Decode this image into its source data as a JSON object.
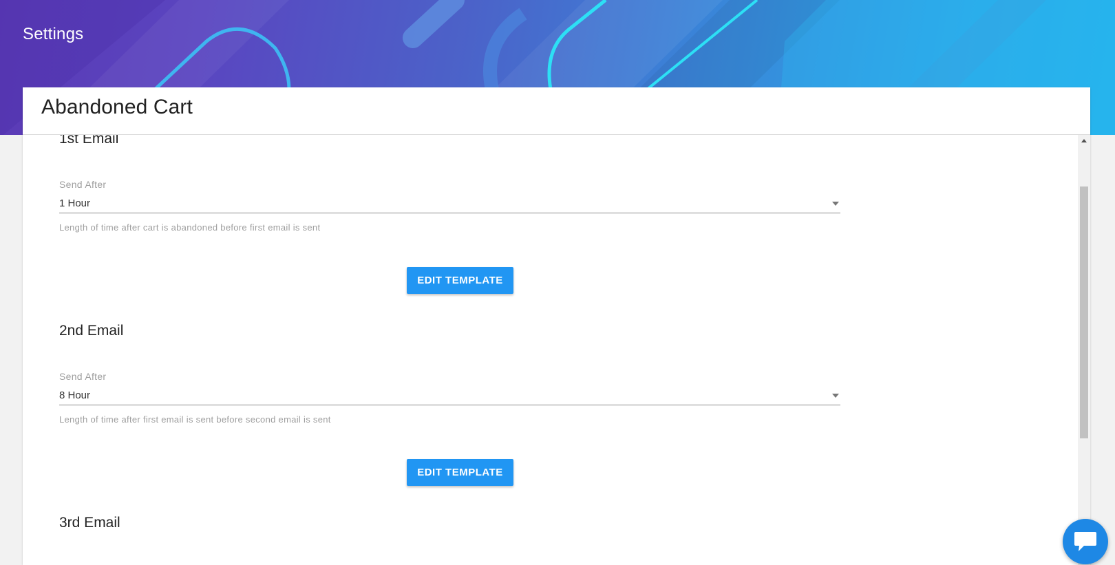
{
  "header": {
    "title": "Settings"
  },
  "card": {
    "title": "Abandoned Cart"
  },
  "emails": [
    {
      "title": "1st Email",
      "field_label": "Send After",
      "selected_value": "1 Hour",
      "helper_text": "Length of time after cart is abandoned before first email is sent",
      "button_label": "EDIT TEMPLATE"
    },
    {
      "title": "2nd Email",
      "field_label": "Send After",
      "selected_value": "8 Hour",
      "helper_text": "Length of time after first email is sent before second email is sent",
      "button_label": "EDIT TEMPLATE"
    },
    {
      "title": "3rd Email"
    }
  ],
  "colors": {
    "primary_button": "#2196f3",
    "chat_fab": "#1e88e5",
    "header_gradient_start": "#5b3ab5",
    "header_gradient_end": "#22b3ec"
  },
  "icons": {
    "chat": "chat-bubble-icon",
    "dropdown": "chevron-down-icon",
    "scroll_up": "scroll-up-arrow-icon"
  }
}
